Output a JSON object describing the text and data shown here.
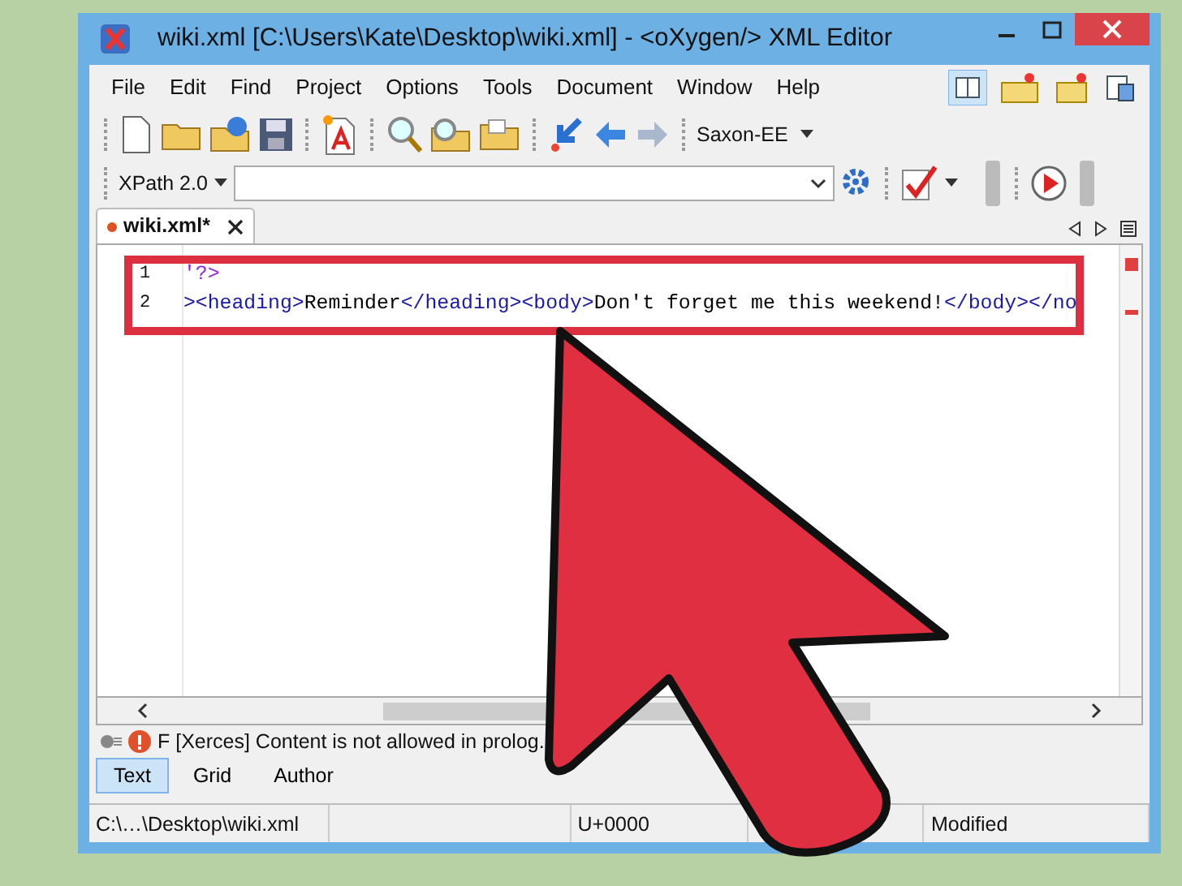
{
  "window": {
    "title": "wiki.xml [C:\\Users\\Kate\\Desktop\\wiki.xml] - <oXygen/> XML Editor"
  },
  "menu": [
    "File",
    "Edit",
    "Find",
    "Project",
    "Options",
    "Tools",
    "Document",
    "Window",
    "Help"
  ],
  "toolbar": {
    "transformer": "Saxon-EE",
    "xpath_version": "XPath 2.0"
  },
  "editor_tabs": [
    {
      "label": "wiki.xml*",
      "modified": true,
      "selected": true
    }
  ],
  "lines": [
    {
      "number": "1",
      "tokens": [
        {
          "kind": "pi",
          "text": "'?>"
        }
      ]
    },
    {
      "number": "2",
      "tokens": [
        {
          "kind": "tag",
          "text": "><heading>"
        },
        {
          "kind": "text",
          "text": "Reminder"
        },
        {
          "kind": "tag",
          "text": "</heading><body>"
        },
        {
          "kind": "text",
          "text": "Don't forget me this weekend!"
        },
        {
          "kind": "tag",
          "text": "</body></no"
        }
      ]
    }
  ],
  "message": {
    "kind": "error",
    "text": "F [Xerces] Content is not allowed in prolog."
  },
  "mode_tabs": [
    {
      "label": "Text",
      "selected": true
    },
    {
      "label": "Grid",
      "selected": false
    },
    {
      "label": "Author",
      "selected": false
    }
  ],
  "status_bar": [
    {
      "kind": "text",
      "text": "C:\\…\\Desktop\\wiki.xml"
    },
    {
      "kind": "blank"
    },
    {
      "kind": "text",
      "text": "U+0000"
    },
    {
      "kind": "blank"
    },
    {
      "kind": "text",
      "text": "Modified"
    }
  ]
}
